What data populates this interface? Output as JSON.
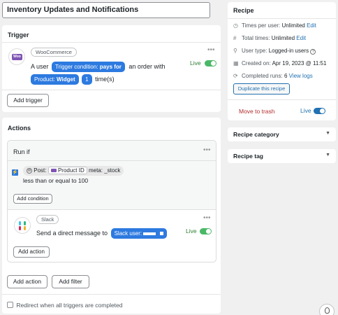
{
  "recipe_title": "Inventory Updates and Notifications",
  "trigger": {
    "heading": "Trigger",
    "integration": "WooCommerce",
    "sentence_prefix": "A user",
    "condition_token": {
      "label": "Trigger condition:",
      "value": "pays for"
    },
    "sentence_middle": "an order with",
    "product_token": {
      "label": "Product:",
      "value": "Widget"
    },
    "count_token": "1",
    "sentence_suffix": "time(s)",
    "status": "Live",
    "add_trigger_label": "Add trigger"
  },
  "actions": {
    "heading": "Actions",
    "run_if": "Run if",
    "condition": {
      "badge_prefix": "Post:",
      "badge_field": "Product ID",
      "badge_suffix": "meta: _stock",
      "comparison": "less than or equal to 100"
    },
    "add_condition_label": "Add condition",
    "slack": {
      "integration": "Slack",
      "sentence": "Send a direct message to",
      "user_token_label": "Slack user:",
      "status": "Live"
    },
    "inner_add_action_label": "Add action",
    "add_action_label": "Add action",
    "add_filter_label": "Add filter",
    "redirect_label": "Redirect when all triggers are completed"
  },
  "sidebar": {
    "recipe_heading": "Recipe",
    "times_per_user": {
      "label": "Times per user:",
      "value": "Unlimited",
      "link": "Edit"
    },
    "total_times": {
      "label": "Total times:",
      "value": "Unlimited",
      "link": "Edit"
    },
    "user_type": {
      "label": "User type:",
      "value": "Logged-in users"
    },
    "created_on": {
      "label": "Created on:",
      "value": "Apr 19, 2023 @ 11:51"
    },
    "completed_runs": {
      "label": "Completed runs:",
      "value": "6",
      "link": "View logs"
    },
    "duplicate_label": "Duplicate this recipe",
    "move_to_trash": "Move to trash",
    "status": "Live",
    "recipe_category": "Recipe category",
    "recipe_tag": "Recipe tag"
  },
  "colors": {
    "accent": "#2271b1",
    "token": "#2d7ae0",
    "live": "#4ab866",
    "trash": "#b32d2e"
  }
}
